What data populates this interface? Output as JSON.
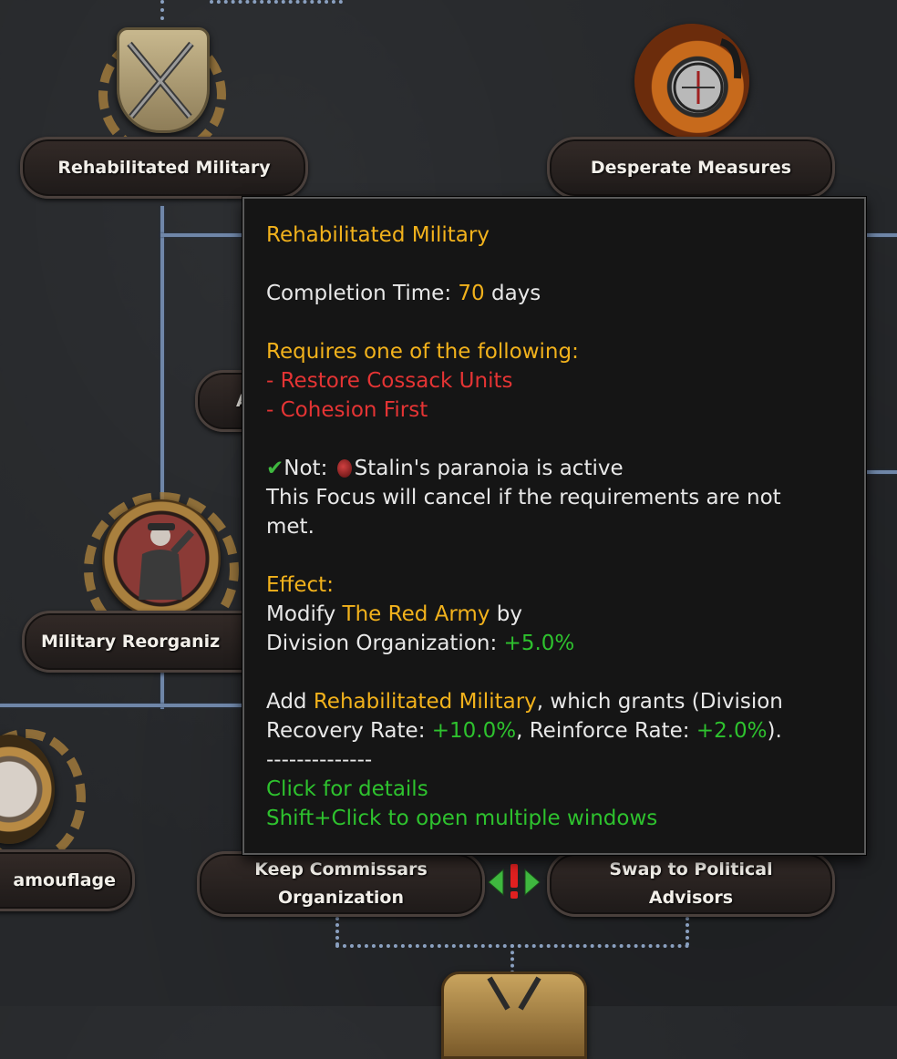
{
  "nodes": {
    "rehabilitated_military": "Rehabilitated Military",
    "desperate_measures": "Desperate Measures",
    "military_reorganization": "Military Reorganiz",
    "camouflage": "amouflage",
    "keep_commissars_line1": "Keep Commissars",
    "keep_commissars_line2": "Organization",
    "swap_political_line1": "Swap to Political",
    "swap_political_line2": "Advisors",
    "hidden_node_letter": "A"
  },
  "icons": {
    "rehabilitated_military": "crossed-rifles-shield-icon",
    "desperate_measures": "compass-fire-icon",
    "military_reorganization": "saluting-officer-icon",
    "camouflage": "camouflage-icon",
    "mutually_exclusive": "mutually-exclusive-icon",
    "bottom": "crossed-swords-icon"
  },
  "tooltip": {
    "title": "Rehabilitated Military",
    "completion_label": "Completion Time: ",
    "completion_value": "70",
    "completion_unit": " days",
    "requires_header": "Requires one of the following:",
    "requires_items": [
      "- Restore Cossack Units",
      "- Cohesion First"
    ],
    "not_label": "Not: ",
    "not_condition": "Stalin's paranoia is active",
    "cancel_text_1": "This Focus will cancel if the requirements are not",
    "cancel_text_2": "met.",
    "effect_header": "Effect:",
    "modify_prefix": "Modify ",
    "modify_target": "The Red Army",
    "modify_suffix": " by",
    "division_org_label": "Division Organization: ",
    "division_org_value": "+5.0%",
    "add_prefix": "Add ",
    "add_target": "Rehabilitated Military",
    "add_suffix": ", which grants (Division",
    "recovery_label": "Recovery Rate: ",
    "recovery_value": "+10.0%",
    "reinforce_label": ", Reinforce Rate: ",
    "reinforce_value": "+2.0%",
    "close_paren": ").",
    "separator": "--------------",
    "click_details": "Click for details",
    "shift_click": "Shift+Click to open multiple windows"
  },
  "colors": {
    "highlight_yellow": "#f2b21c",
    "requirement_red": "#e43434",
    "positive_green": "#2ec22e",
    "line_blue": "#6f86a8"
  }
}
